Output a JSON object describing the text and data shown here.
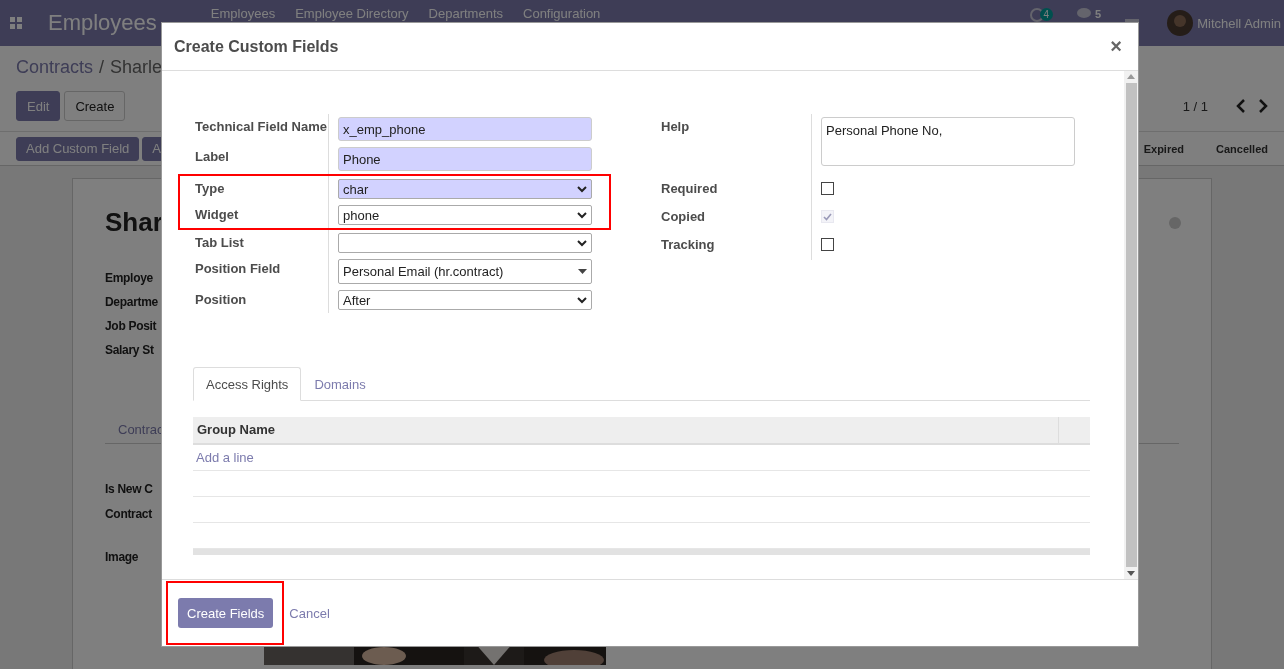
{
  "navbar": {
    "app_title": "Employees",
    "menu": [
      "Employees",
      "Employee Directory",
      "Departments",
      "Configuration"
    ],
    "activity_count": "4",
    "message_count": "5",
    "user": "Mitchell Admin"
  },
  "breadcrumb": {
    "parent": "Contracts",
    "separator": "/",
    "current": "Sharle"
  },
  "actions": [
    {
      "label": "Edit",
      "primary": true
    },
    {
      "label": "Create",
      "primary": false
    }
  ],
  "pager": "1 / 1",
  "status_buttons": [
    "Add Custom Field",
    "A"
  ],
  "stages": [
    "Expired",
    "Cancelled"
  ],
  "sheet": {
    "title": "Shar",
    "labels": [
      "Employe",
      "Departme",
      "Job Posit",
      "Salary St"
    ],
    "tab": "Contrac",
    "labels_2": [
      "Is New C",
      "Contract"
    ],
    "image_label": "Image"
  },
  "dialog": {
    "title": "Create Custom Fields",
    "close": "×",
    "left_fields": [
      {
        "label": "Technical Field Name",
        "kind": "input",
        "value": "x_emp_phone",
        "required": true,
        "highlighted": false
      },
      {
        "label": "Label",
        "kind": "input",
        "value": "Phone",
        "required": true,
        "highlighted": false
      },
      {
        "label": "Type",
        "kind": "select",
        "value": "char",
        "required": true,
        "highlighted": true
      },
      {
        "label": "Widget",
        "kind": "select",
        "value": "phone",
        "required": false,
        "highlighted": true
      },
      {
        "label": "Tab List",
        "kind": "select",
        "required": false,
        "highlighted": false
      },
      {
        "label": "Position Field",
        "kind": "autocomplete",
        "value": "Personal Email (hr.contract)",
        "required": false,
        "highlighted": false
      },
      {
        "label": "Position",
        "kind": "select",
        "value": "After",
        "required": false,
        "highlighted": false
      }
    ],
    "right_fields": [
      {
        "label": "Help",
        "kind": "textarea",
        "value": "Personal Phone No,"
      },
      {
        "label": "Required",
        "kind": "checkbox",
        "checked": false,
        "disabled": false
      },
      {
        "label": "Copied",
        "kind": "checkbox",
        "checked": true,
        "disabled": true
      },
      {
        "label": "Tracking",
        "kind": "checkbox",
        "checked": false,
        "disabled": false
      }
    ],
    "tabs": [
      {
        "label": "Access Rights",
        "selected": true
      },
      {
        "label": "Domains",
        "selected": false
      }
    ],
    "table": {
      "columns": [
        "Group Name"
      ],
      "add_line": "Add a line"
    },
    "primary_button": {
      "label": "Create Fields",
      "highlighted": true
    },
    "cancel": "Cancel"
  }
}
